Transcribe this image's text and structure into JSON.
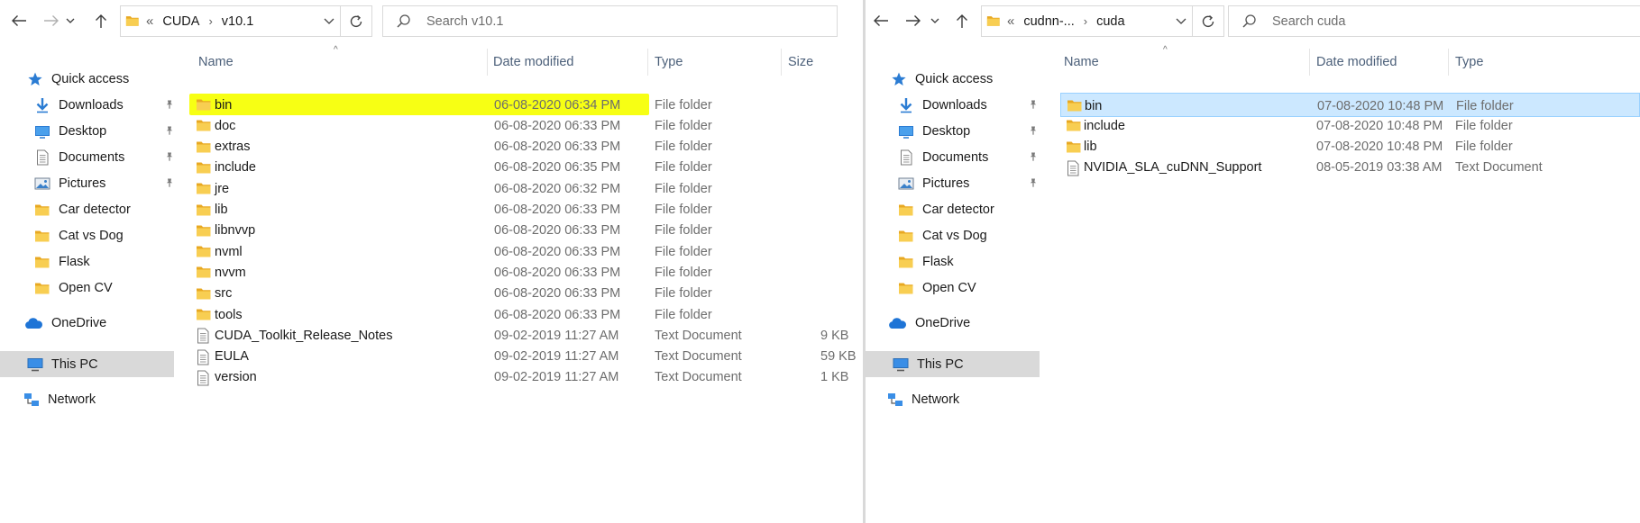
{
  "colors": {
    "highlight_yellow": "#f6ff00",
    "highlight_green": "#c5e000",
    "selection_blue": "#cce8ff",
    "folder_yellow": "#f5c344",
    "header_text": "#4c607a"
  },
  "left_window": {
    "address": {
      "overflow": "«",
      "crumbs": [
        "CUDA",
        "v10.1"
      ]
    },
    "search_placeholder": "Search v10.1",
    "columns": {
      "name": "Name",
      "date": "Date modified",
      "type": "Type",
      "size": "Size"
    },
    "nav": {
      "quick_access": "Quick access",
      "downloads": "Downloads",
      "desktop": "Desktop",
      "documents": "Documents",
      "pictures": "Pictures",
      "car_detector": "Car detector",
      "cat_vs_dog": "Cat vs Dog",
      "flask": "Flask",
      "open_cv": "Open CV",
      "onedrive": "OneDrive",
      "this_pc": "This PC",
      "network": "Network"
    },
    "files": [
      {
        "name": "bin",
        "date": "06-08-2020 06:34 PM",
        "type": "File folder",
        "size": "",
        "icon": "folder-icon"
      },
      {
        "name": "doc",
        "date": "06-08-2020 06:33 PM",
        "type": "File folder",
        "size": "",
        "icon": "folder-icon"
      },
      {
        "name": "extras",
        "date": "06-08-2020 06:33 PM",
        "type": "File folder",
        "size": "",
        "icon": "folder-icon"
      },
      {
        "name": "include",
        "date": "06-08-2020 06:35 PM",
        "type": "File folder",
        "size": "",
        "icon": "folder-icon"
      },
      {
        "name": "jre",
        "date": "06-08-2020 06:32 PM",
        "type": "File folder",
        "size": "",
        "icon": "folder-icon"
      },
      {
        "name": "lib",
        "date": "06-08-2020 06:33 PM",
        "type": "File folder",
        "size": "",
        "icon": "folder-icon"
      },
      {
        "name": "libnvvp",
        "date": "06-08-2020 06:33 PM",
        "type": "File folder",
        "size": "",
        "icon": "folder-icon"
      },
      {
        "name": "nvml",
        "date": "06-08-2020 06:33 PM",
        "type": "File folder",
        "size": "",
        "icon": "folder-icon"
      },
      {
        "name": "nvvm",
        "date": "06-08-2020 06:33 PM",
        "type": "File folder",
        "size": "",
        "icon": "folder-icon"
      },
      {
        "name": "src",
        "date": "06-08-2020 06:33 PM",
        "type": "File folder",
        "size": "",
        "icon": "folder-icon"
      },
      {
        "name": "tools",
        "date": "06-08-2020 06:33 PM",
        "type": "File folder",
        "size": "",
        "icon": "folder-icon"
      },
      {
        "name": "CUDA_Toolkit_Release_Notes",
        "date": "09-02-2019 11:27 AM",
        "type": "Text Document",
        "size": "9 KB",
        "icon": "text-document-icon"
      },
      {
        "name": "EULA",
        "date": "09-02-2019 11:27 AM",
        "type": "Text Document",
        "size": "59 KB",
        "icon": "text-document-icon"
      },
      {
        "name": "version",
        "date": "09-02-2019 11:27 AM",
        "type": "Text Document",
        "size": "1 KB",
        "icon": "text-document-icon"
      }
    ]
  },
  "right_window": {
    "address": {
      "overflow": "«",
      "crumbs": [
        "cudnn-...",
        "cuda"
      ]
    },
    "search_placeholder": "Search cuda",
    "columns": {
      "name": "Name",
      "date": "Date modified",
      "type": "Type"
    },
    "nav": {
      "quick_access": "Quick access",
      "downloads": "Downloads",
      "desktop": "Desktop",
      "documents": "Documents",
      "pictures": "Pictures",
      "car_detector": "Car detector",
      "cat_vs_dog": "Cat vs Dog",
      "flask": "Flask",
      "open_cv": "Open CV",
      "onedrive": "OneDrive",
      "this_pc": "This PC",
      "network": "Network"
    },
    "files": [
      {
        "name": "bin",
        "date": "07-08-2020 10:48 PM",
        "type": "File folder",
        "icon": "folder-icon"
      },
      {
        "name": "include",
        "date": "07-08-2020 10:48 PM",
        "type": "File folder",
        "icon": "folder-icon"
      },
      {
        "name": "lib",
        "date": "07-08-2020 10:48 PM",
        "type": "File folder",
        "icon": "folder-icon"
      },
      {
        "name": "NVIDIA_SLA_cuDNN_Support",
        "date": "08-05-2019 03:38 AM",
        "type": "Text Document",
        "icon": "text-document-icon"
      }
    ]
  }
}
